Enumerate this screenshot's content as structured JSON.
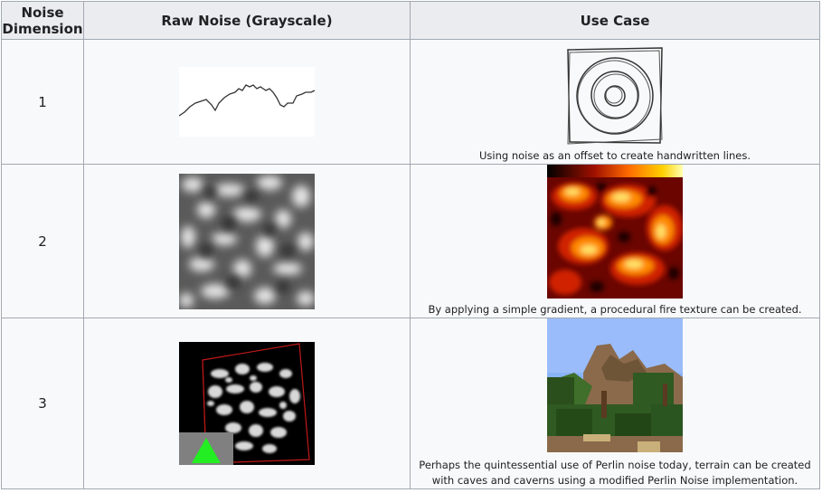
{
  "headers": {
    "dimension": "Noise Dimension",
    "raw_noise": "Raw Noise (Grayscale)",
    "use_case": "Use Case"
  },
  "rows": [
    {
      "dimension": "1",
      "raw_image": "1d-noise-line-graph",
      "use_image": "handdrawn-concentric-circles",
      "caption": "Using noise as an offset to create handwritten lines."
    },
    {
      "dimension": "2",
      "raw_image": "2d-grayscale-noise-texture",
      "use_image": "procedural-fire-texture",
      "caption": "By applying a simple gradient, a procedural fire texture can be created."
    },
    {
      "dimension": "3",
      "raw_image": "3d-noise-volume-render",
      "use_image": "voxel-terrain-screenshot",
      "caption": "Perhaps the quintessential use of Perlin noise today, terrain can be created with caves and caverns using a modified Perlin Noise implementation."
    }
  ],
  "colors": {
    "header_bg": "#eaecf0",
    "cell_bg": "#f8f9fa",
    "border": "#a2a9b1"
  }
}
